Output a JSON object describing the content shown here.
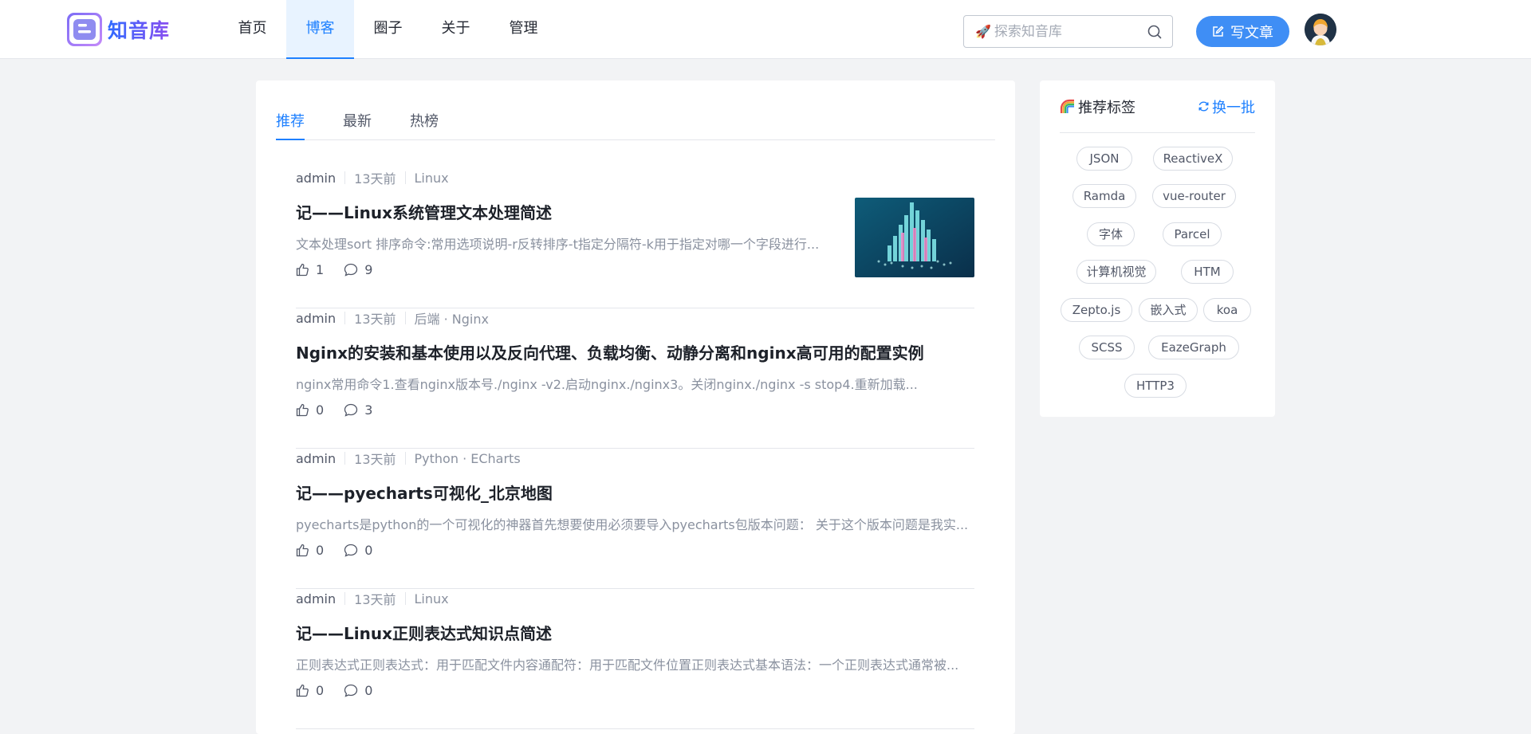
{
  "header": {
    "logo_text": "知音库",
    "nav": [
      "首页",
      "博客",
      "圈子",
      "关于",
      "管理"
    ],
    "active_nav": "博客",
    "search_placeholder": "探索知音库",
    "write_label": "写文章"
  },
  "feed": {
    "tabs": [
      "推荐",
      "最新",
      "热榜"
    ],
    "active_tab": "推荐",
    "articles": [
      {
        "author": "admin",
        "time": "13天前",
        "tags": "Linux",
        "title": "记——Linux系统管理文本处理简述",
        "abstract": "文本处理sort 排序命令:常用选项说明-r反转排序-t指定分隔符-k用于指定对哪一个字段进行...",
        "likes": "1",
        "comments": "9",
        "has_thumb": true
      },
      {
        "author": "admin",
        "time": "13天前",
        "tags": "后端 · Nginx",
        "title": "Nginx的安装和基本使用以及反向代理、负载均衡、动静分离和nginx高可用的配置实例",
        "abstract": "nginx常用命令1.查看nginx版本号./nginx -v2.启动nginx./nginx3。关闭nginx./nginx -s stop4.重新加载...",
        "likes": "0",
        "comments": "3",
        "has_thumb": false
      },
      {
        "author": "admin",
        "time": "13天前",
        "tags": "Python · ECharts",
        "title": "记——pyecharts可视化_北京地图",
        "abstract": "pyecharts是python的一个可视化的神器首先想要使用必须要导入pyecharts包版本问题： 关于这个版本问题是我实...",
        "likes": "0",
        "comments": "0",
        "has_thumb": false
      },
      {
        "author": "admin",
        "time": "13天前",
        "tags": "Linux",
        "title": "记——Linux正则表达式知识点简述",
        "abstract": "正则表达式正则表达式：用于匹配文件内容通配符：用于匹配文件位置正则表达式基本语法：一个正则表达式通常被...",
        "likes": "0",
        "comments": "0",
        "has_thumb": false
      }
    ]
  },
  "sidebar": {
    "title": "推荐标签",
    "refresh_label": "换一批",
    "tags": [
      "JSON",
      "ReactiveX",
      "Ramda",
      "vue-router",
      "字体",
      "Parcel",
      "计算机视觉",
      "HTM",
      "Zepto.js",
      "嵌入式",
      "koa",
      "SCSS",
      "EazeGraph",
      "HTTP3"
    ]
  },
  "colors": {
    "accent": "#1e80ff",
    "button": "#3f8ef5",
    "page_bg": "#f2f3f5"
  }
}
